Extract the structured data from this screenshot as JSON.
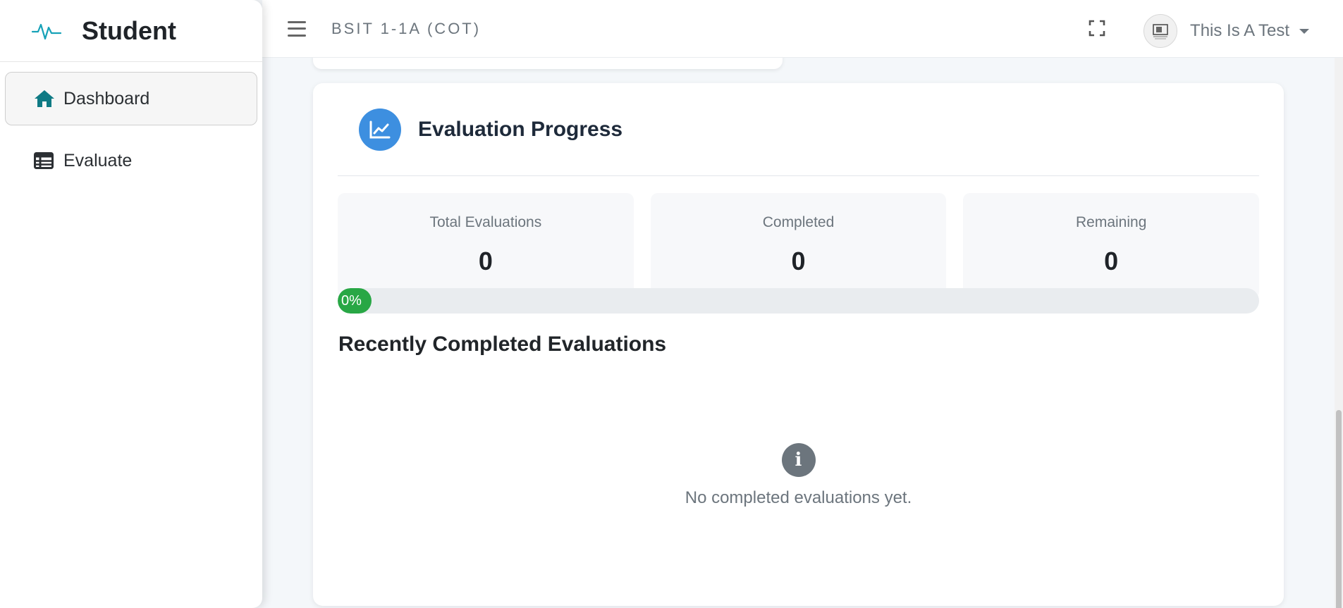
{
  "sidebar": {
    "brand": "Student",
    "items": [
      {
        "label": "Dashboard",
        "icon": "home-icon",
        "active": true
      },
      {
        "label": "Evaluate",
        "icon": "table-icon",
        "active": false
      }
    ]
  },
  "topbar": {
    "title": "BSIT 1-1A (COT)",
    "user_name": "This Is A Test"
  },
  "progress_card": {
    "title": "Evaluation Progress",
    "stats": [
      {
        "label": "Total Evaluations",
        "value": "0"
      },
      {
        "label": "Completed",
        "value": "0"
      },
      {
        "label": "Remaining",
        "value": "0"
      }
    ],
    "progress_label": "0%",
    "progress_value": 0,
    "recent_title": "Recently Completed Evaluations",
    "empty_message": "No completed evaluations yet."
  },
  "colors": {
    "brand_accent": "#17a2b8",
    "active_icon": "#0f7a84",
    "header_icon_bg": "#3d8fe0",
    "progress": "#28a745"
  }
}
